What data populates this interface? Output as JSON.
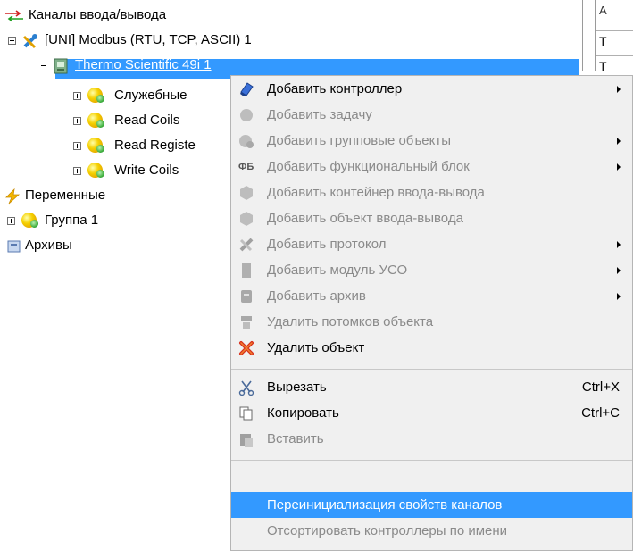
{
  "tree": {
    "io_channels": "Каналы ввода/вывода",
    "modbus": "[UNI] Modbus (RTU, TCP, ASCII) 1",
    "controller": "Thermo Scientific 49i 1",
    "service": "Служебные",
    "read_coils": "Read Coils",
    "read_registers": "Read Registe",
    "write_coils": "Write Coils",
    "variables": "Переменные",
    "group1": "Группа 1",
    "archives": "Архивы"
  },
  "right_panel": {
    "cell1": "T",
    "cell2": "T"
  },
  "menu": {
    "add_controller": "Добавить контроллер",
    "add_task": "Добавить задачу",
    "add_group_objects": "Добавить групповые объекты",
    "add_function_block": "Добавить функциональный блок",
    "fb_icon_label": "ФБ",
    "add_io_container": "Добавить контейнер ввода-вывода",
    "add_io_object": "Добавить объект ввода-вывода",
    "add_protocol": "Добавить протокол",
    "add_uso_module": "Добавить модуль УСО",
    "add_archive": "Добавить архив",
    "delete_children": "Удалить потомков объекта",
    "delete_object": "Удалить объект",
    "cut": "Вырезать",
    "cut_shortcut": "Ctrl+X",
    "copy": "Копировать",
    "copy_shortcut": "Ctrl+C",
    "paste": "Вставить",
    "reinit_channels": "Переинициализация свойств каналов",
    "sort_controllers": "Отсортировать контроллеры по имени"
  },
  "colors": {
    "selection": "#3399ff",
    "menu_bg": "#f0f0f0",
    "disabled_text": "#8a8a8a"
  }
}
